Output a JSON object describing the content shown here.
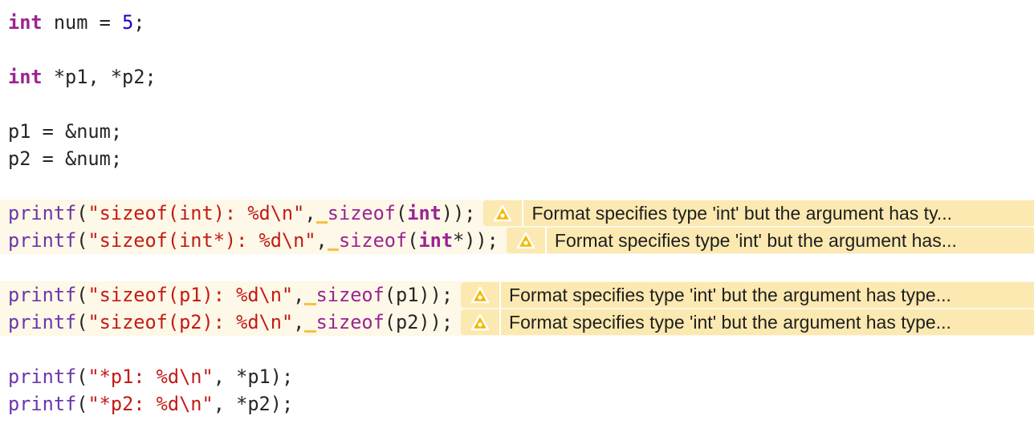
{
  "colors": {
    "keyword": "#9b2393",
    "number": "#1c00cf",
    "function": "#6c36a9",
    "string": "#c41a16",
    "warning_bg": "#fbe9b1",
    "warning_icon": "#f5b800",
    "line_highlight": "#fdf8e7"
  },
  "lines": [
    {
      "tokens": [
        {
          "t": "int",
          "c": "kw"
        },
        {
          "t": " num = "
        },
        {
          "t": "5",
          "c": "num"
        },
        {
          "t": ";"
        }
      ]
    },
    {
      "tokens": []
    },
    {
      "tokens": [
        {
          "t": "int",
          "c": "kw"
        },
        {
          "t": " *p1, *p2;"
        }
      ]
    },
    {
      "tokens": []
    },
    {
      "tokens": [
        {
          "t": "p1 = &num;"
        }
      ]
    },
    {
      "tokens": [
        {
          "t": "p2 = &num;"
        }
      ]
    },
    {
      "tokens": []
    },
    {
      "tokens": [
        {
          "t": "printf",
          "c": "fn"
        },
        {
          "t": "("
        },
        {
          "t": "\"sizeof(int): %d\\n\"",
          "c": "str"
        },
        {
          "t": ","
        },
        {
          "t": " ",
          "c": "fixit"
        },
        {
          "t": "sizeof",
          "c": "kwn"
        },
        {
          "t": "("
        },
        {
          "t": "int",
          "c": "kw"
        },
        {
          "t": "));"
        }
      ],
      "warning": {
        "icon": "warning-triangle-icon",
        "message": "Format specifies type 'int' but the argument has ty..."
      }
    },
    {
      "tokens": [
        {
          "t": "printf",
          "c": "fn"
        },
        {
          "t": "("
        },
        {
          "t": "\"sizeof(int*): %d\\n\"",
          "c": "str"
        },
        {
          "t": ","
        },
        {
          "t": " ",
          "c": "fixit"
        },
        {
          "t": "sizeof",
          "c": "kwn"
        },
        {
          "t": "("
        },
        {
          "t": "int",
          "c": "kw"
        },
        {
          "t": "*));"
        }
      ],
      "warning": {
        "icon": "warning-triangle-icon",
        "message": "Format specifies type 'int' but the argument has..."
      }
    },
    {
      "tokens": []
    },
    {
      "tokens": [
        {
          "t": "printf",
          "c": "fn"
        },
        {
          "t": "("
        },
        {
          "t": "\"sizeof(p1): %d\\n\"",
          "c": "str"
        },
        {
          "t": ","
        },
        {
          "t": " ",
          "c": "fixit"
        },
        {
          "t": "sizeof",
          "c": "kwn"
        },
        {
          "t": "(p1));"
        }
      ],
      "warning": {
        "icon": "warning-triangle-icon",
        "message": "Format specifies type 'int' but the argument has type..."
      }
    },
    {
      "tokens": [
        {
          "t": "printf",
          "c": "fn"
        },
        {
          "t": "("
        },
        {
          "t": "\"sizeof(p2): %d\\n\"",
          "c": "str"
        },
        {
          "t": ","
        },
        {
          "t": " ",
          "c": "fixit"
        },
        {
          "t": "sizeof",
          "c": "kwn"
        },
        {
          "t": "(p2));"
        }
      ],
      "warning": {
        "icon": "warning-triangle-icon",
        "message": "Format specifies type 'int' but the argument has type..."
      }
    },
    {
      "tokens": []
    },
    {
      "tokens": [
        {
          "t": "printf",
          "c": "fn"
        },
        {
          "t": "("
        },
        {
          "t": "\"*p1: %d\\n\"",
          "c": "str"
        },
        {
          "t": ", *p1);"
        }
      ]
    },
    {
      "tokens": [
        {
          "t": "printf",
          "c": "fn"
        },
        {
          "t": "("
        },
        {
          "t": "\"*p2: %d\\n\"",
          "c": "str"
        },
        {
          "t": ", *p2);"
        }
      ]
    }
  ]
}
